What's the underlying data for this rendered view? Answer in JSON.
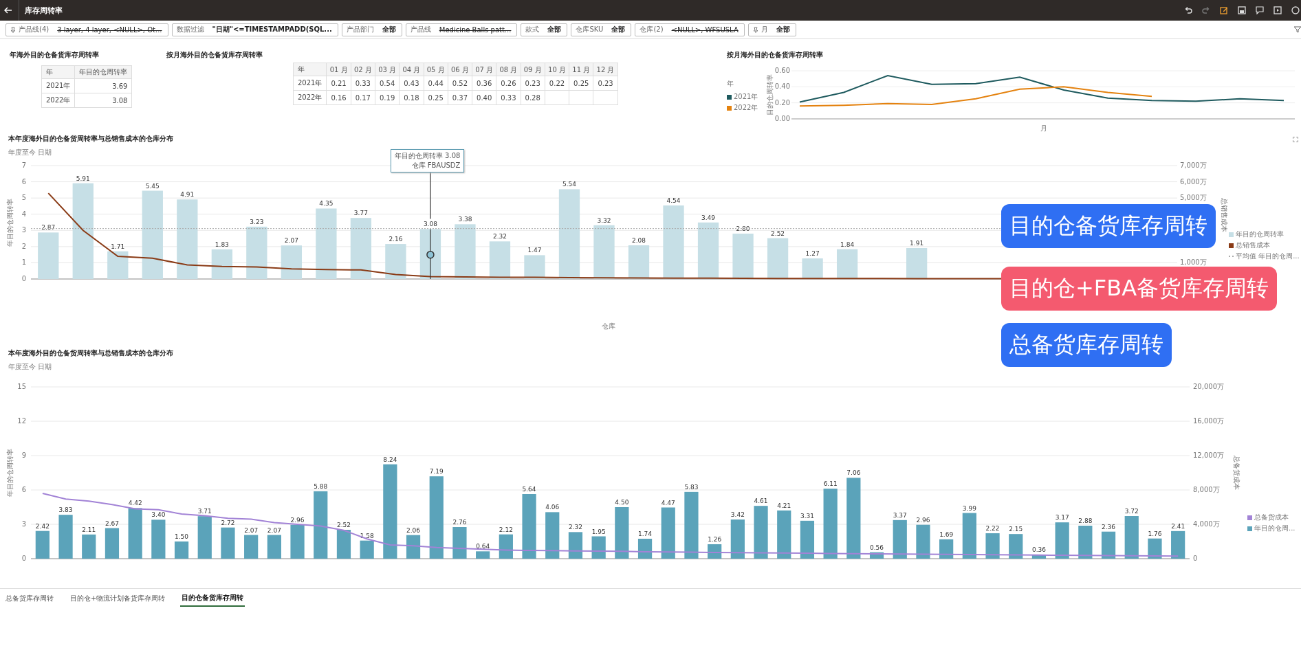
{
  "header": {
    "title": "库存周转率"
  },
  "filters": [
    {
      "pinned": true,
      "label": "产品线",
      "count": "(4)",
      "value": "3 layer, 4 layer, <NULL>, Ot...",
      "excluded": true
    },
    {
      "pinned": false,
      "label": "数据过滤",
      "value": "\"日期\"<=TIMESTAMPADD(SQL...",
      "excluded": false
    },
    {
      "pinned": false,
      "label": "产品部门",
      "value": "全部",
      "excluded": false
    },
    {
      "pinned": false,
      "label": "产品线",
      "value": "Medicine Balls patt...",
      "excluded": true
    },
    {
      "pinned": false,
      "label": "款式",
      "value": "全部",
      "excluded": false
    },
    {
      "pinned": false,
      "label": "仓库SKU",
      "value": "全部",
      "excluded": false
    },
    {
      "pinned": false,
      "label": "仓库",
      "count": "(2)",
      "value": "<NULL>, WFSUSLA",
      "excluded": true
    },
    {
      "pinned": true,
      "label": "月",
      "value": "全部",
      "excluded": false
    }
  ],
  "year_table": {
    "title": "年海外目的仓备货库存周转率",
    "columns": [
      "年",
      "年目的仓周转率"
    ],
    "rows": [
      [
        "2021年",
        "3.69"
      ],
      [
        "2022年",
        "3.08"
      ]
    ]
  },
  "month_table": {
    "title": "按月海外目的仓备货库存周转率",
    "columns": [
      "年",
      "01 月",
      "02 月",
      "03 月",
      "04 月",
      "05 月",
      "06 月",
      "07 月",
      "08 月",
      "09 月",
      "10 月",
      "11 月",
      "12 月"
    ],
    "rows": [
      [
        "2021年",
        "0.21",
        "0.33",
        "0.54",
        "0.43",
        "0.44",
        "0.52",
        "0.36",
        "0.26",
        "0.23",
        "0.22",
        "0.25",
        "0.23"
      ],
      [
        "2022年",
        "0.16",
        "0.17",
        "0.19",
        "0.18",
        "0.25",
        "0.37",
        "0.40",
        "0.33",
        "0.28"
      ]
    ]
  },
  "month_chart": {
    "title": "按月海外目的仓备货库存周转率",
    "legend_title": "年",
    "chart_data": {
      "type": "line",
      "xlabel": "月",
      "ylabel": "目的仓周转率",
      "legend": "left",
      "series": [
        {
          "name": "2021年",
          "color": "#1e5a5e",
          "values": [
            0.21,
            0.33,
            0.54,
            0.43,
            0.44,
            0.52,
            0.36,
            0.26,
            0.23,
            0.22,
            0.25,
            0.23
          ]
        },
        {
          "name": "2022年",
          "color": "#e4820f",
          "values": [
            0.16,
            0.17,
            0.19,
            0.18,
            0.25,
            0.37,
            0.4,
            0.33,
            0.28,
            null,
            null,
            null
          ]
        }
      ],
      "ylim": [
        0,
        0.6
      ],
      "yticks": [
        {
          "value": 0,
          "label": "0.00"
        },
        {
          "value": 0.2,
          "label": "0.20"
        },
        {
          "value": 0.4,
          "label": "0.40"
        },
        {
          "value": 0.6,
          "label": "0.60"
        }
      ],
      "grid": true
    }
  },
  "warehouse_chart": {
    "title": "本年度海外目的仓备货周转率与总销售成本的仓库分布",
    "subtitle": "年度至今 日期",
    "chart_data": {
      "type": "bar",
      "xlabel": "仓库",
      "ylabel": "年目的仓周转率",
      "series": [
        {
          "name": "年目的仓周转率",
          "color": "#c6dfe6",
          "values": [
            2.87,
            5.91,
            1.71,
            5.45,
            4.91,
            1.83,
            3.23,
            2.07,
            4.35,
            3.77,
            2.16,
            3.08,
            3.38,
            2.32,
            1.47,
            5.54,
            3.32,
            2.08,
            4.54,
            3.49,
            2.8,
            2.52,
            1.27,
            1.84,
            null,
            1.91,
            null,
            null,
            null,
            null,
            null,
            null,
            null
          ]
        }
      ],
      "ylim": [
        0,
        7
      ],
      "yticks": [
        0,
        1,
        2,
        3,
        4,
        5,
        6,
        7
      ],
      "grid": true,
      "value_labels": [
        "2.87",
        "5.91",
        "1.71",
        "5.45",
        "4.91",
        "1.83",
        "3.23",
        "2.07",
        "4.35",
        "3.77",
        "2.16",
        "3.08",
        "3.38",
        "2.32",
        "1.47",
        "5.54",
        "3.32",
        "2.08",
        "4.54",
        "3.49",
        "2.80",
        "2.52",
        "1.27",
        "1.84",
        null,
        "1.91",
        null,
        null,
        null,
        null,
        null,
        null,
        null
      ]
    },
    "right_axis": {
      "label": "总销售成本",
      "ticks": [
        "7,000万",
        "6,000万",
        "5,000万",
        "1,000万"
      ]
    },
    "legend": [
      {
        "kind": "series",
        "color": "#c6dfe6"
      },
      {
        "kind": "square",
        "label": "总销售成本",
        "color": "#8a3b16"
      },
      {
        "kind": "dotted",
        "label": "平均值 年目的仓周...",
        "color": "#aaaaaa"
      }
    ],
    "tooltip": {
      "lines": [
        "年目的仓周转率  3.08",
        "仓库  FBAUSDZ"
      ]
    }
  },
  "stock_chart": {
    "title": "本年度海外目的仓备货周转率与总销售成本的仓库分布",
    "subtitle": "年度至今 日期",
    "chart_data": {
      "type": "bar",
      "ylabel": "年目的仓周转率",
      "series": [
        {
          "name": "年目的仓周...",
          "color": "#5ba3ba",
          "values": [
            2.42,
            3.83,
            2.11,
            2.67,
            4.42,
            3.4,
            1.5,
            3.71,
            2.72,
            2.07,
            2.07,
            2.96,
            5.88,
            2.52,
            1.58,
            8.24,
            2.06,
            7.19,
            2.76,
            0.64,
            2.12,
            5.64,
            4.06,
            2.32,
            1.95,
            4.5,
            1.74,
            4.47,
            5.83,
            1.26,
            3.42,
            4.61,
            4.21,
            3.31,
            6.11,
            7.06,
            0.56,
            3.37,
            2.96,
            1.69,
            3.99,
            2.22,
            2.15,
            0.36,
            3.17,
            2.88,
            2.36,
            3.72,
            1.76,
            2.41
          ]
        }
      ],
      "ylim": [
        0,
        15
      ],
      "yticks": [
        0,
        3,
        6,
        9,
        12,
        15
      ],
      "grid": true,
      "value_labels": [
        "2.42",
        "3.83",
        "2.11",
        "2.67",
        "4.42",
        "3.40",
        "1.50",
        "3.71",
        "2.72",
        "2.07",
        "2.07",
        "2.96",
        "5.88",
        "2.52",
        "1.58",
        "8.24",
        "2.06",
        "7.19",
        "2.76",
        "0.64",
        "2.12",
        "5.64",
        "4.06",
        "2.32",
        "1.95",
        "4.50",
        "1.74",
        "4.47",
        "5.83",
        "1.26",
        "3.42",
        "4.61",
        "4.21",
        "3.31",
        "6.11",
        "7.06",
        "0.56",
        "3.37",
        "2.96",
        "1.69",
        "3.99",
        "2.22",
        "2.15",
        "0.36",
        "3.17",
        "2.88",
        "2.36",
        "3.72",
        "1.76",
        "2.41"
      ]
    },
    "right_axis": {
      "label": "总备货成本",
      "ticks": [
        "20,000万",
        "16,000万",
        "12,000万",
        "8,000万",
        "4,000万",
        "0"
      ]
    },
    "legend": [
      {
        "kind": "square",
        "label": "总备货成本",
        "color": "#a283d6"
      },
      {
        "kind": "series",
        "color": "#5ba3ba"
      }
    ]
  },
  "quick_links": [
    {
      "label": "目的仓备货库存周转",
      "color": "#2f6ff3"
    },
    {
      "label": "目的仓+FBA备货库存周转",
      "color": "#f45a6f"
    },
    {
      "label": "总备货库存周转",
      "color": "#2f6ff3"
    }
  ],
  "tabs": [
    {
      "label": "总备货库存周转",
      "selected": false
    },
    {
      "label": "目的仓+物流计划备货库存周转",
      "selected": false
    },
    {
      "label": "目的仓备货库存周转",
      "selected": true
    }
  ]
}
